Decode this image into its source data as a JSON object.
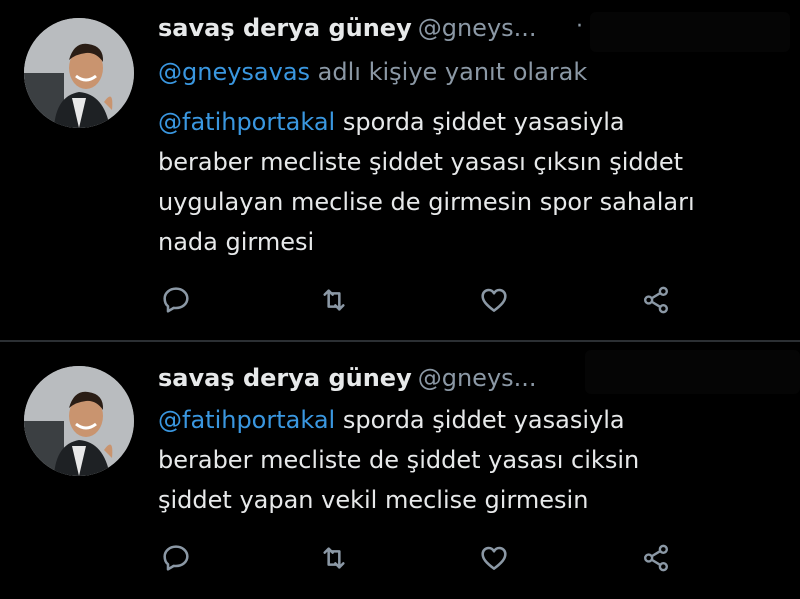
{
  "tweets": [
    {
      "author_name": "savaş derya güney",
      "author_handle": "@gneys...",
      "separator": "·",
      "reply_prefix": "@gneysavas",
      "reply_suffix": " adlı kişiye yanıt olarak",
      "mention": "@fatihportakal",
      "lines": [
        " sporda şiddet yasasiyla",
        "beraber mecliste şiddet yasası çıksın şiddet",
        "uygulayan meclise de girmesin spor sahaları",
        "nada girmesi"
      ]
    },
    {
      "author_name": "savaş derya güney",
      "author_handle": "@gneys...",
      "mention": "@fatihportakal",
      "lines": [
        " sporda şiddet yasasiyla",
        "beraber mecliste de şiddet yasası ciksin",
        "şiddet yapan vekil meclise girmesin"
      ]
    }
  ],
  "icons": {
    "reply": "reply-icon",
    "retweet": "retweet-icon",
    "like": "heart-icon",
    "share": "share-icon"
  },
  "colors": {
    "background": "#000000",
    "text": "#e7e9ea",
    "secondary": "#8b98a5",
    "link": "#3a97e0",
    "divider": "#2b2f33"
  }
}
